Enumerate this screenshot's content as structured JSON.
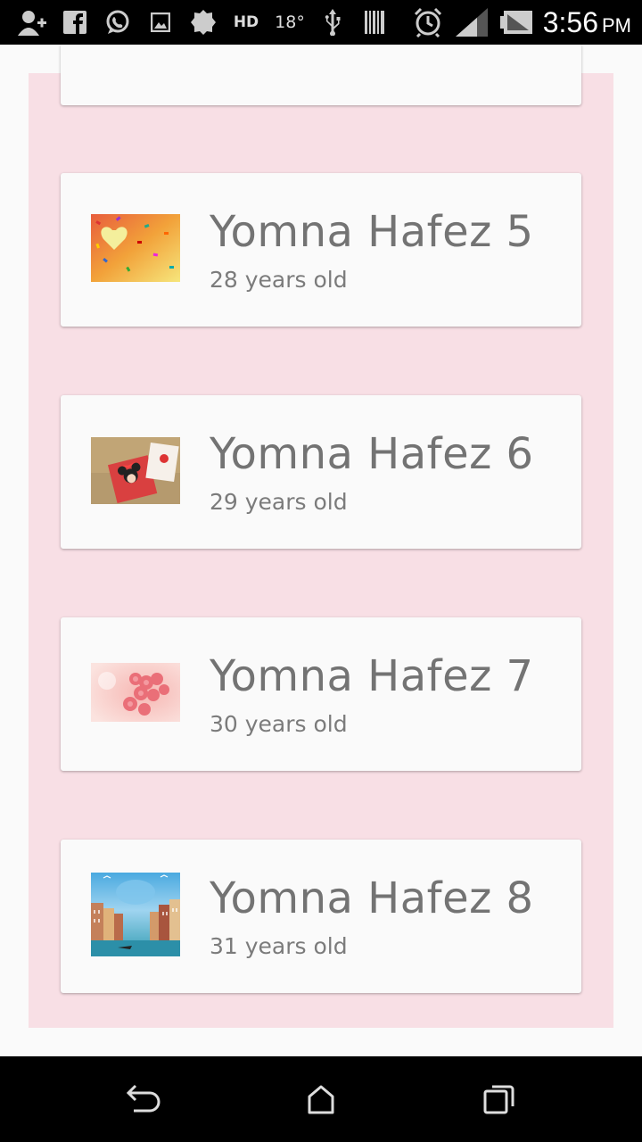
{
  "status_bar": {
    "time": "3:56",
    "ampm": "PM",
    "temperature": "18°",
    "hd_label": "HD",
    "icons": [
      "add-contact-icon",
      "facebook-icon",
      "whatsapp-icon",
      "gallery-icon",
      "settings-badge-icon",
      "hd-icon",
      "temperature-icon",
      "usb-icon",
      "barcode-icon",
      "alarm-icon",
      "signal-icon",
      "battery-icon"
    ]
  },
  "list": {
    "background_color": "#f8dfe5",
    "items": [
      {
        "name": "Yomna Hafez 5",
        "age": "28 years old",
        "thumb": "heart-candy-image"
      },
      {
        "name": "Yomna Hafez 6",
        "age": "29 years old",
        "thumb": "minnie-mouse-image"
      },
      {
        "name": "Yomna Hafez 7",
        "age": "30 years old",
        "thumb": "pink-roses-image"
      },
      {
        "name": "Yomna Hafez 8",
        "age": "31 years old",
        "thumb": "venice-image"
      }
    ]
  },
  "nav_bar": {
    "buttons": [
      "back-button",
      "home-button",
      "recents-button"
    ]
  }
}
